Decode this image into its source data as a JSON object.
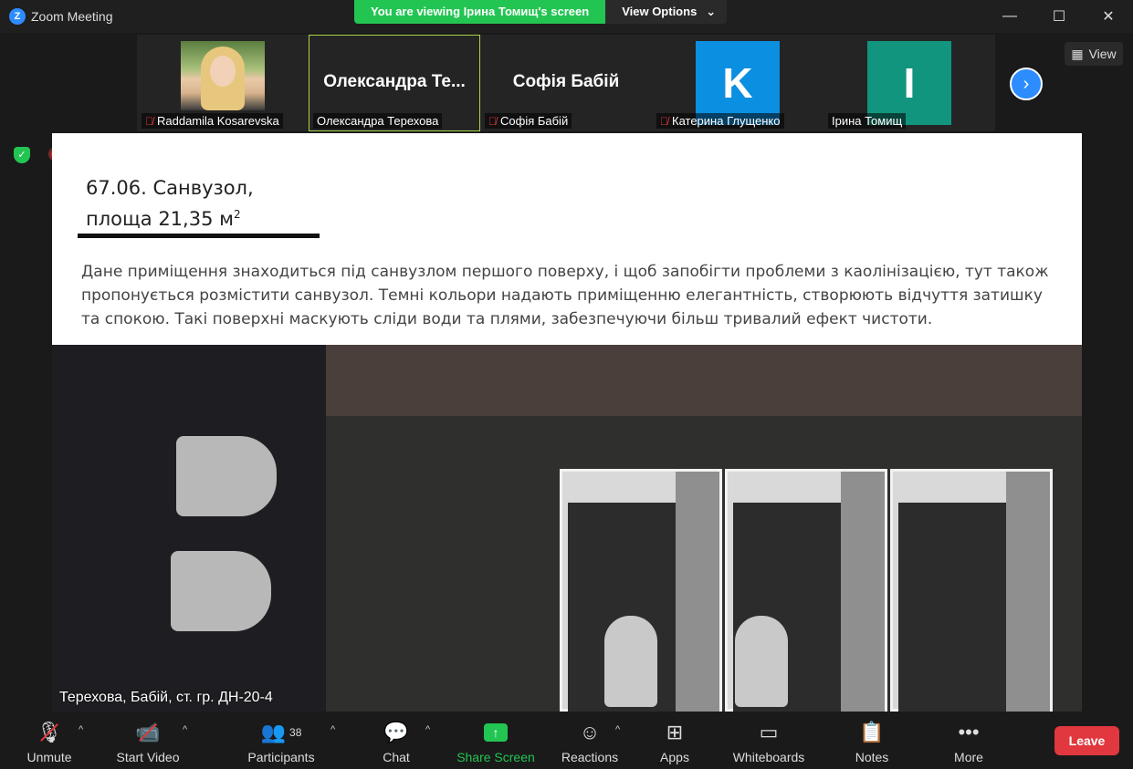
{
  "window": {
    "title": "Zoom Meeting",
    "logo_letter": "Z",
    "minimize": "—",
    "maximize": "☐",
    "close": "✕"
  },
  "share_banner": {
    "viewing_text": "You are viewing Ірина Томищ's screen",
    "view_options_label": "View Options",
    "caret": "⌄"
  },
  "gallery": {
    "participants": [
      {
        "name": "Raddamila Kosarevska",
        "muted": true,
        "display": "photo"
      },
      {
        "name": "Олександра Терехова",
        "muted": false,
        "display": "name",
        "big_name": "Олександра Те..."
      },
      {
        "name": "Софія Бабій",
        "muted": true,
        "display": "name",
        "big_name": "Софія Бабій"
      },
      {
        "name": "Катерина Глущенко",
        "muted": true,
        "display": "letter",
        "letter": "K",
        "color": "#0b8fe0"
      },
      {
        "name": "Ірина Томищ",
        "muted": false,
        "display": "letter",
        "letter": "I",
        "color": "#11957f"
      }
    ],
    "next_arrow": "›",
    "view_label": "View"
  },
  "slide": {
    "title_line1": "67.06. Санвузол,",
    "title_line2": "площа 21,35 м",
    "title_sup": "2",
    "body": "Дане приміщення знаходиться під санвузлом першого поверху, і щоб запобігти проблеми з каолінізацією, тут також пропонується розмістити санвузол. Темні кольори надають приміщенню елегантність, створюють відчуття затишку та спокою. Такі поверхні маскують сліди води та плями, забезпечуючи більш тривалий ефект чистоти.",
    "caption": "Терехова, Бабій, ст. гр. ДН-20-4"
  },
  "toolbar": {
    "unmute": "Unmute",
    "start_video": "Start Video",
    "participants": "Participants",
    "participant_count": "38",
    "chat": "Chat",
    "share_screen": "Share Screen",
    "reactions": "Reactions",
    "apps": "Apps",
    "whiteboards": "Whiteboards",
    "notes": "Notes",
    "more": "More",
    "leave": "Leave",
    "caret_up": "^"
  },
  "colors": {
    "share_green": "#23c552",
    "leave_red": "#e0383e",
    "zoom_blue": "#2d8cff",
    "active_tile_border": "#a8d34a"
  }
}
